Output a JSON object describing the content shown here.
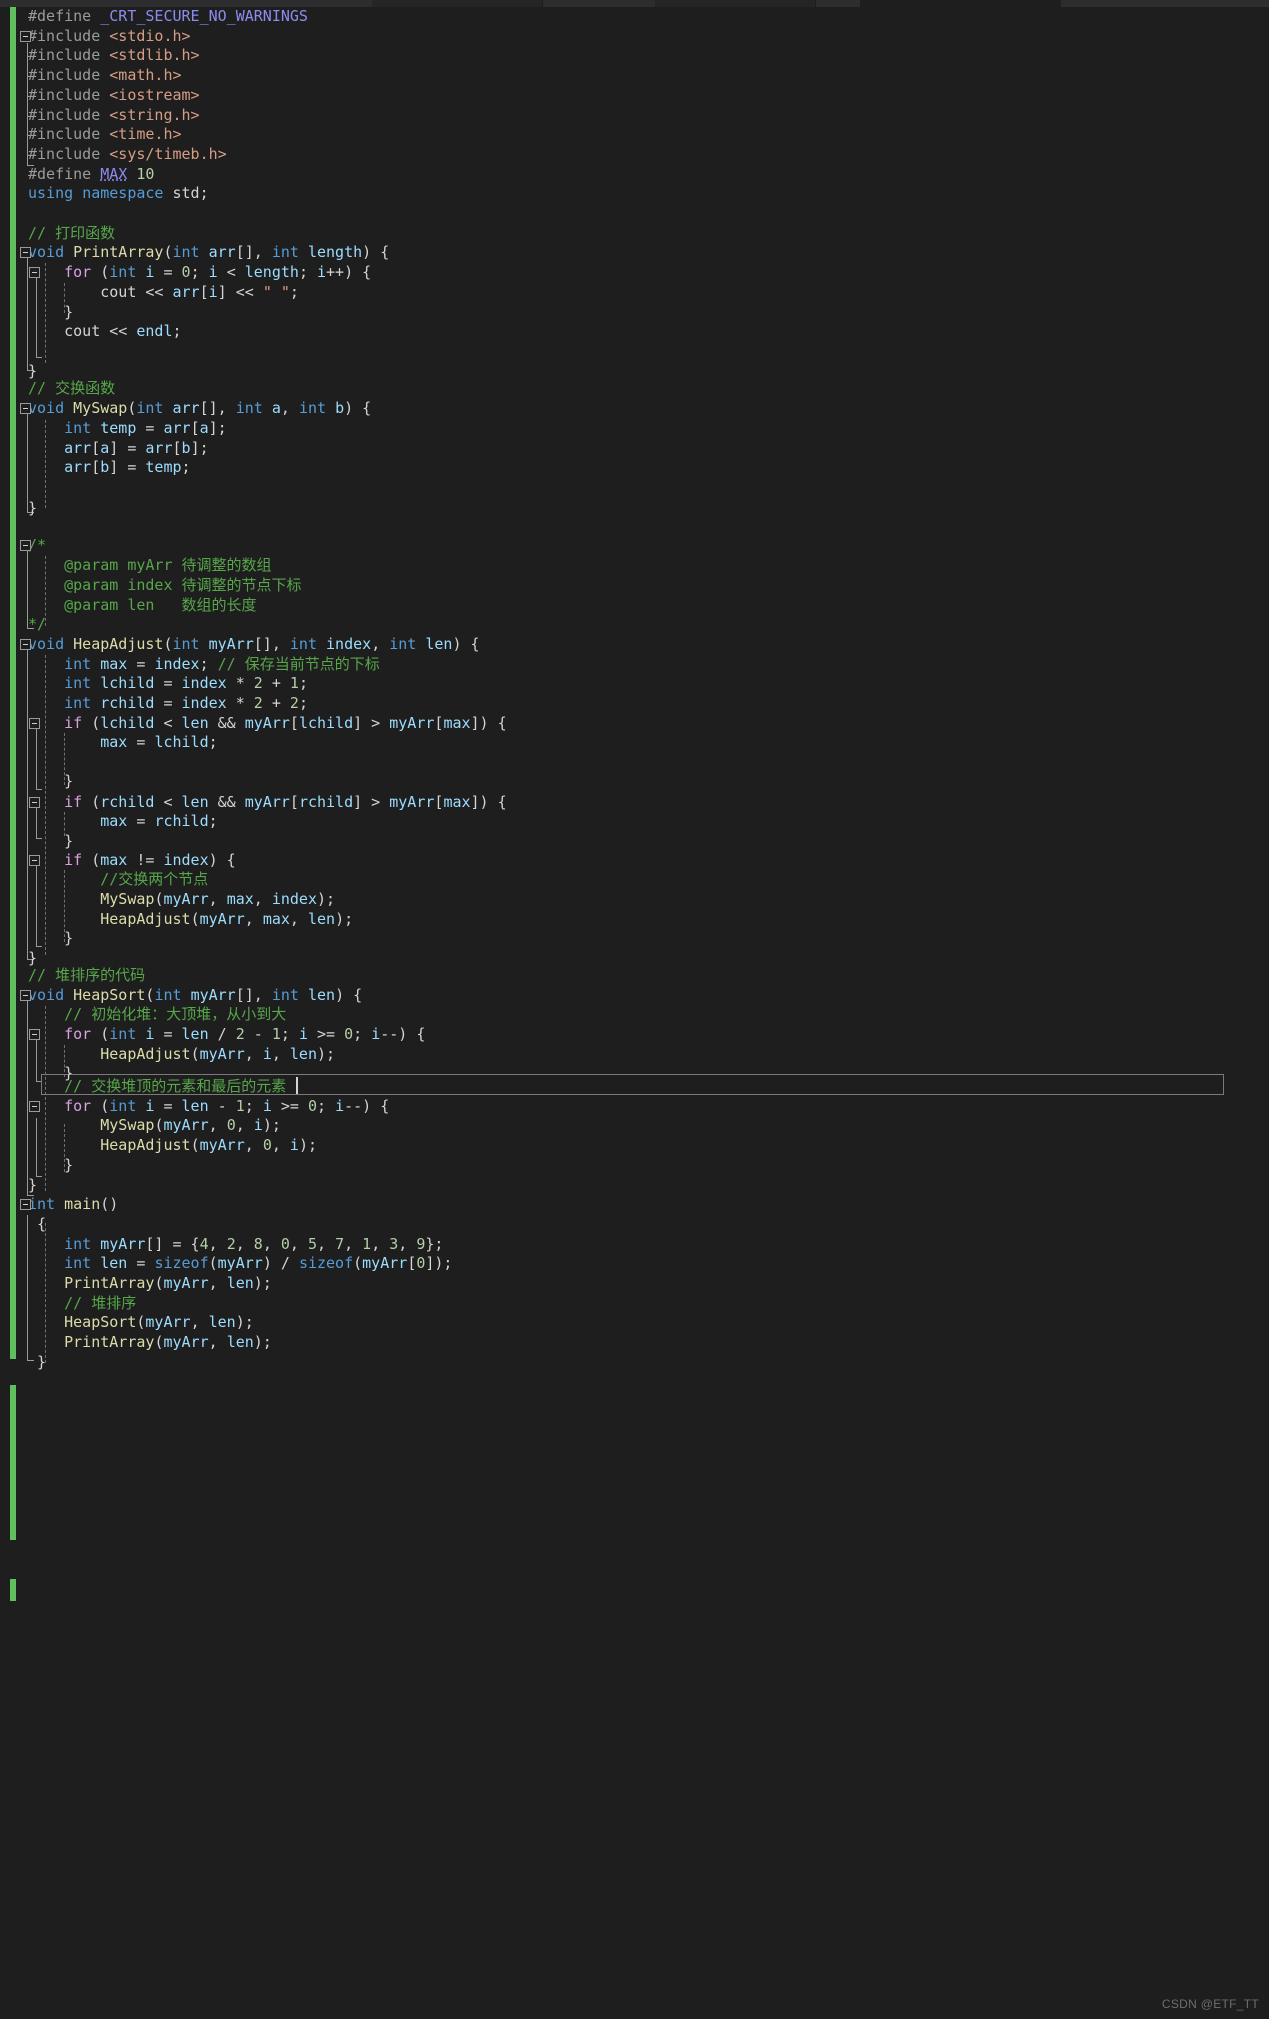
{
  "window": {
    "theme": "visual-studio-dark",
    "background": "#1e1e1e",
    "change_bar_color": "#60c060"
  },
  "watermark": {
    "text": "CSDN @ETF_TT"
  },
  "palette": {
    "preprocessor": "#9B9B9B",
    "macro_name": "#8C8CF0",
    "include_path": "#D69D85",
    "keyword": "#569CD6",
    "control_keyword": "#D8A0DF",
    "function": "#DCDCAA",
    "variable": "#9CDCFE",
    "number": "#B5CEA8",
    "comment": "#57A64A",
    "string": "#D69D85",
    "plain": "#d4d4d4"
  },
  "editor": {
    "language": "C++",
    "current_line_index": 54,
    "caret_visible": true,
    "lines": [
      {
        "i": 0,
        "text": "#define _CRT_SECURE_NO_WARNINGS"
      },
      {
        "i": 1,
        "text": "#include <stdio.h>"
      },
      {
        "i": 2,
        "text": "#include <stdlib.h>"
      },
      {
        "i": 3,
        "text": "#include <math.h>"
      },
      {
        "i": 4,
        "text": "#include <iostream>"
      },
      {
        "i": 5,
        "text": "#include <string.h>"
      },
      {
        "i": 6,
        "text": "#include <time.h>"
      },
      {
        "i": 7,
        "text": "#include <sys/timeb.h>"
      },
      {
        "i": 8,
        "text": "#define MAX 10"
      },
      {
        "i": 9,
        "text": "using namespace std;"
      },
      {
        "i": 10,
        "text": ""
      },
      {
        "i": 11,
        "text": "// 打印函数"
      },
      {
        "i": 12,
        "text": "void PrintArray(int arr[], int length) {"
      },
      {
        "i": 13,
        "text": "    for (int i = 0; i < length; i++) {"
      },
      {
        "i": 14,
        "text": "        cout << arr[i] << \" \";"
      },
      {
        "i": 15,
        "text": "    }"
      },
      {
        "i": 16,
        "text": "    cout << endl;"
      },
      {
        "i": 17,
        "text": ""
      },
      {
        "i": 18,
        "text": ""
      },
      {
        "i": 19,
        "text": "}"
      },
      {
        "i": 20,
        "text": "// 交换函数"
      },
      {
        "i": 21,
        "text": "void MySwap(int arr[], int a, int b) {"
      },
      {
        "i": 22,
        "text": "    int temp = arr[a];"
      },
      {
        "i": 23,
        "text": "    arr[a] = arr[b];"
      },
      {
        "i": 24,
        "text": "    arr[b] = temp;"
      },
      {
        "i": 25,
        "text": ""
      },
      {
        "i": 26,
        "text": ""
      },
      {
        "i": 27,
        "text": "}"
      },
      {
        "i": 28,
        "text": ""
      },
      {
        "i": 29,
        "text": "/*"
      },
      {
        "i": 30,
        "text": "    @param myArr 待调整的数组"
      },
      {
        "i": 31,
        "text": "    @param index 待调整的节点下标"
      },
      {
        "i": 32,
        "text": "    @param len   数组的长度"
      },
      {
        "i": 33,
        "text": "*/"
      },
      {
        "i": 34,
        "text": "void HeapAdjust(int myArr[], int index, int len) {"
      },
      {
        "i": 35,
        "text": "    int max = index; // 保存当前节点的下标"
      },
      {
        "i": 36,
        "text": "    int lchild = index * 2 + 1;"
      },
      {
        "i": 37,
        "text": "    int rchild = index * 2 + 2;"
      },
      {
        "i": 38,
        "text": "    if (lchild < len && myArr[lchild] > myArr[max]) {"
      },
      {
        "i": 39,
        "text": "        max = lchild;"
      },
      {
        "i": 40,
        "text": ""
      },
      {
        "i": 41,
        "text": ""
      },
      {
        "i": 42,
        "text": "    }"
      },
      {
        "i": 43,
        "text": "    if (rchild < len && myArr[rchild] > myArr[max]) {"
      },
      {
        "i": 44,
        "text": "        max = rchild;"
      },
      {
        "i": 45,
        "text": "    }"
      },
      {
        "i": 46,
        "text": "    if (max != index) {"
      },
      {
        "i": 47,
        "text": "        //交换两个节点"
      },
      {
        "i": 48,
        "text": "        MySwap(myArr, max, index);"
      },
      {
        "i": 49,
        "text": "        HeapAdjust(myArr, max, len);"
      },
      {
        "i": 50,
        "text": "    }"
      },
      {
        "i": 51,
        "text": "}"
      },
      {
        "i": 52,
        "text": "// 堆排序的代码"
      },
      {
        "i": 53,
        "text": "void HeapSort(int myArr[], int len) {"
      },
      {
        "i": 54,
        "text": "    // 初始化堆：大顶堆，从小到大"
      },
      {
        "i": 55,
        "text": "    for (int i = len / 2 - 1; i >= 0; i--) {"
      },
      {
        "i": 56,
        "text": "        HeapAdjust(myArr, i, len);"
      },
      {
        "i": 57,
        "text": "    }"
      },
      {
        "i": 58,
        "text": "    // 交换堆顶的元素和最后的元素"
      },
      {
        "i": 59,
        "text": "    for (int i = len - 1; i >= 0; i--) {"
      },
      {
        "i": 60,
        "text": "        MySwap(myArr, 0, i);"
      },
      {
        "i": 61,
        "text": "        HeapAdjust(myArr, 0, i);"
      },
      {
        "i": 62,
        "text": "    }"
      },
      {
        "i": 63,
        "text": "}"
      },
      {
        "i": 64,
        "text": "int main()"
      },
      {
        "i": 65,
        "text": "{"
      },
      {
        "i": 66,
        "text": "    int myArr[] = {4, 2, 8, 0, 5, 7, 1, 3, 9};"
      },
      {
        "i": 67,
        "text": "    int len = sizeof(myArr) / sizeof(myArr[0]);"
      },
      {
        "i": 68,
        "text": "    PrintArray(myArr, len);"
      },
      {
        "i": 69,
        "text": "    // 堆排序"
      },
      {
        "i": 70,
        "text": "    HeapSort(myArr, len);"
      },
      {
        "i": 71,
        "text": "    PrintArray(myArr, len);"
      },
      {
        "i": 72,
        "text": "}"
      }
    ],
    "highlighted_line_text": "    // 交换堆顶的元素和最后的元素",
    "fold_markers_at_lines": [
      1,
      12,
      13,
      21,
      29,
      34,
      38,
      43,
      46,
      53,
      55,
      59,
      64
    ]
  }
}
